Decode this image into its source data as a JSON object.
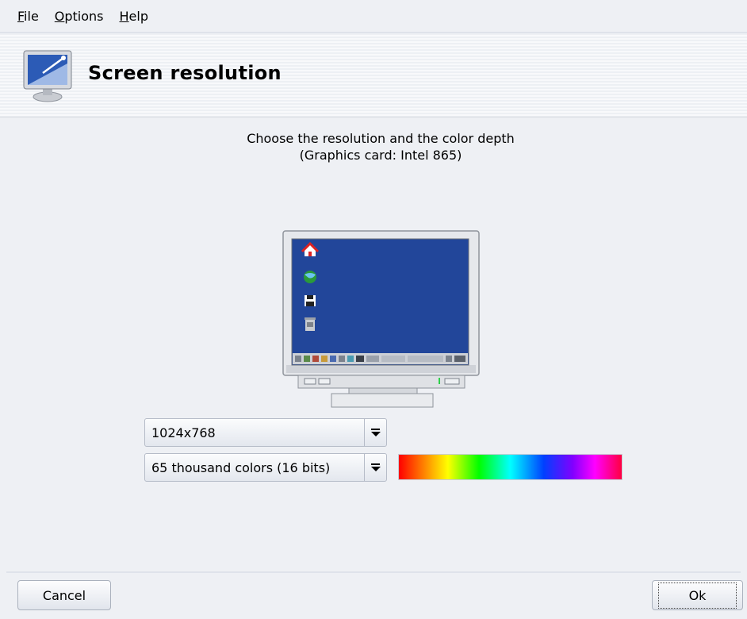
{
  "menubar": {
    "items": [
      {
        "accel": "F",
        "rest": "ile"
      },
      {
        "accel": "O",
        "rest": "ptions"
      },
      {
        "accel": "H",
        "rest": "elp"
      }
    ]
  },
  "header": {
    "title": "Screen resolution"
  },
  "instructions": {
    "line1": "Choose the resolution and the color depth",
    "line2": "(Graphics card: Intel 865)"
  },
  "resolution_select": {
    "value": "1024x768"
  },
  "color_depth_select": {
    "value": "65 thousand colors (16 bits)"
  },
  "buttons": {
    "cancel": "Cancel",
    "ok": "Ok"
  },
  "colors": {
    "desktop_blue": "#22469a",
    "window_bg": "#eef0f4"
  },
  "icons": [
    "monitor-settings-icon",
    "home-icon",
    "globe-icon",
    "floppy-icon",
    "trash-icon"
  ]
}
